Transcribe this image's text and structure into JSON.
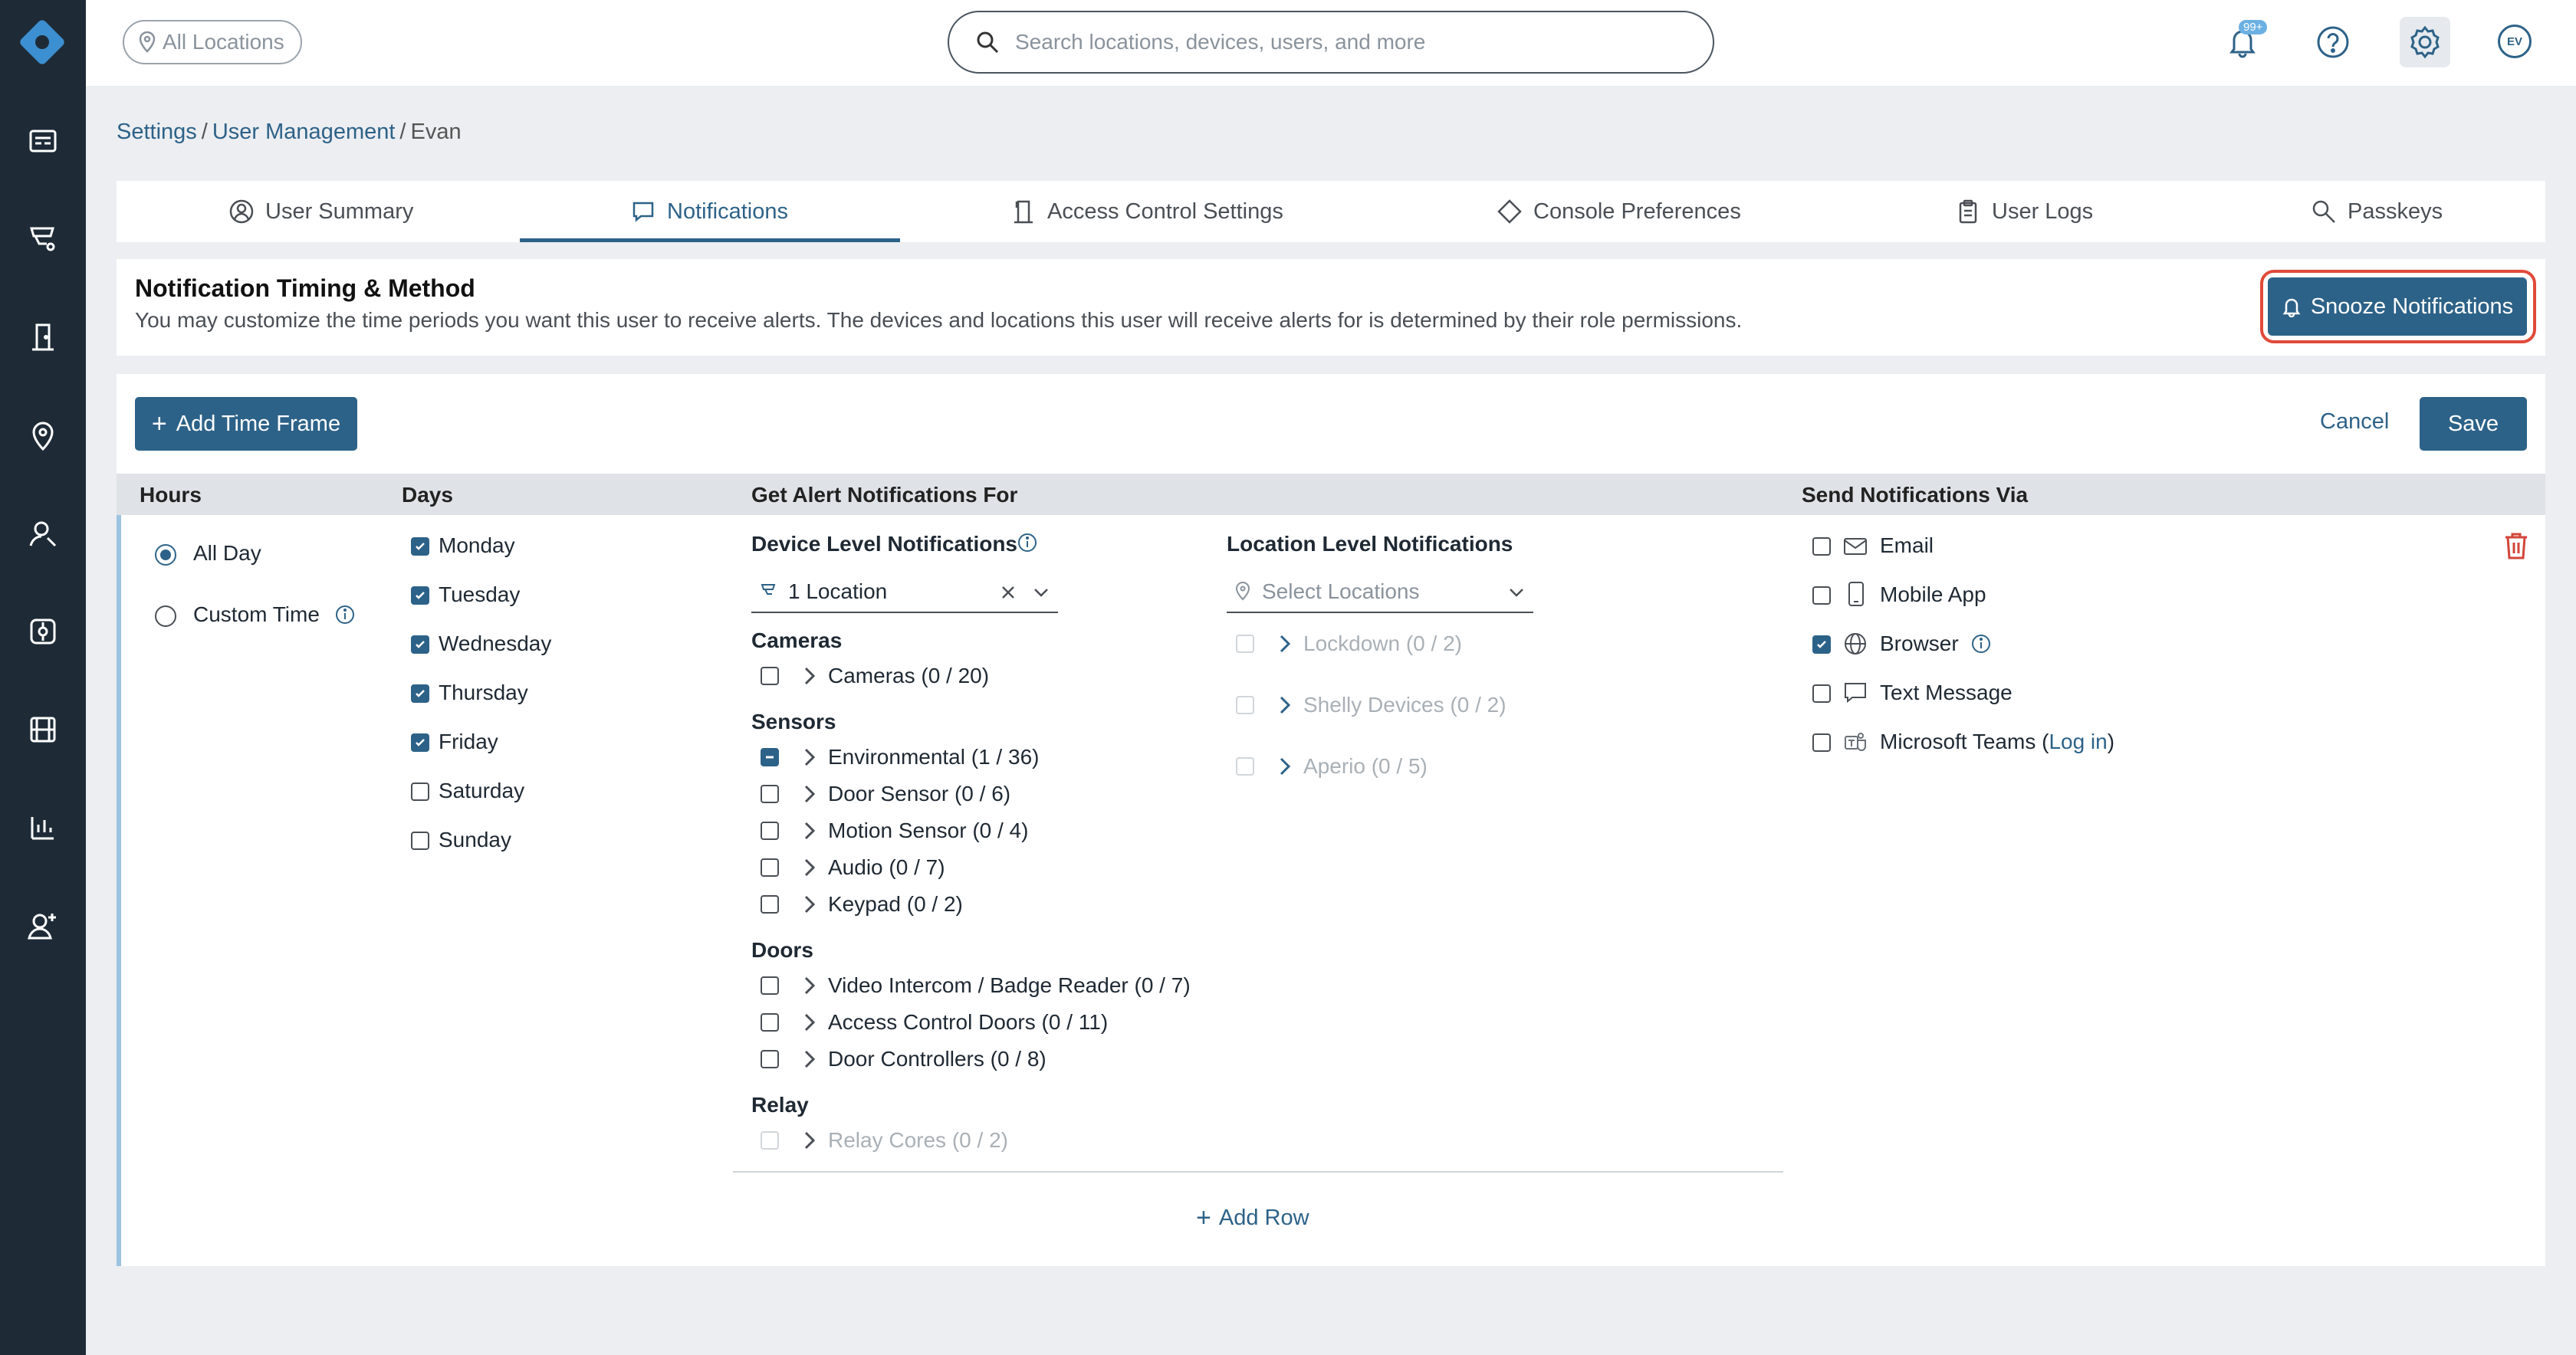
{
  "search": {
    "placeholder": "Search locations, devices, users, and more"
  },
  "location_filter": {
    "label": "All Locations"
  },
  "notifications": {
    "badge": "99+"
  },
  "user": {
    "initials": "EV"
  },
  "breadcrumb": {
    "items": [
      "Settings",
      "User Management",
      "Evan"
    ]
  },
  "tabs": [
    "User Summary",
    "Notifications",
    "Access Control Settings",
    "Console Preferences",
    "User Logs",
    "Passkeys"
  ],
  "info": {
    "title": "Notification Timing & Method",
    "description": "You may customize the time periods you want this user to receive alerts. The devices and locations this user will receive alerts for is determined by their role permissions.",
    "snooze_label": "Snooze Notifications"
  },
  "toolbar": {
    "add_time_frame": "Add Time Frame",
    "cancel": "Cancel",
    "save": "Save"
  },
  "columns": {
    "hours": "Hours",
    "days": "Days",
    "alerts": "Get Alert Notifications For",
    "send": "Send Notifications Via"
  },
  "hours": {
    "all_day": "All Day",
    "custom_time": "Custom Time",
    "selected": "All Day"
  },
  "days": [
    {
      "label": "Monday",
      "checked": true
    },
    {
      "label": "Tuesday",
      "checked": true
    },
    {
      "label": "Wednesday",
      "checked": true
    },
    {
      "label": "Thursday",
      "checked": true
    },
    {
      "label": "Friday",
      "checked": true
    },
    {
      "label": "Saturday",
      "checked": false
    },
    {
      "label": "Sunday",
      "checked": false
    }
  ],
  "device_level": {
    "title": "Device Level Notifications",
    "select_value": "1 Location",
    "groups": {
      "cameras": {
        "title": "Cameras",
        "items": [
          {
            "label": "Cameras (0 / 20)",
            "state": "unchecked"
          }
        ]
      },
      "sensors": {
        "title": "Sensors",
        "items": [
          {
            "label": "Environmental (1 / 36)",
            "state": "partial"
          },
          {
            "label": "Door Sensor (0 / 6)",
            "state": "unchecked"
          },
          {
            "label": "Motion Sensor (0 / 4)",
            "state": "unchecked"
          },
          {
            "label": "Audio (0 / 7)",
            "state": "unchecked"
          },
          {
            "label": "Keypad (0 / 2)",
            "state": "unchecked"
          }
        ]
      },
      "doors": {
        "title": "Doors",
        "items": [
          {
            "label": "Video Intercom / Badge Reader (0 / 7)",
            "state": "unchecked"
          },
          {
            "label": "Access Control Doors (0 / 11)",
            "state": "unchecked"
          },
          {
            "label": "Door Controllers (0 / 8)",
            "state": "unchecked"
          }
        ]
      },
      "relay": {
        "title": "Relay",
        "items": [
          {
            "label": "Relay Cores (0 / 2)",
            "state": "disabled"
          }
        ]
      }
    }
  },
  "location_level": {
    "title": "Location Level Notifications",
    "placeholder": "Select Locations",
    "items": [
      {
        "label": "Lockdown (0 / 2)",
        "state": "disabled"
      },
      {
        "label": "Shelly Devices (0 / 2)",
        "state": "disabled"
      },
      {
        "label": "Aperio (0 / 5)",
        "state": "disabled"
      }
    ]
  },
  "send_via": [
    {
      "label": "Email",
      "checked": false,
      "icon": "mail-icon"
    },
    {
      "label": "Mobile App",
      "checked": false,
      "icon": "phone-icon"
    },
    {
      "label": "Browser",
      "checked": true,
      "icon": "globe-icon"
    },
    {
      "label": "Text Message",
      "checked": false,
      "icon": "message-icon"
    },
    {
      "label": "Microsoft Teams",
      "checked": false,
      "icon": "teams-icon",
      "link": "Log in"
    }
  ],
  "add_row": "Add Row",
  "colors": {
    "accent": "#2d6288",
    "sidebar": "#1e2b37",
    "delete": "#d2453a",
    "highlight": "#e04a3a"
  }
}
